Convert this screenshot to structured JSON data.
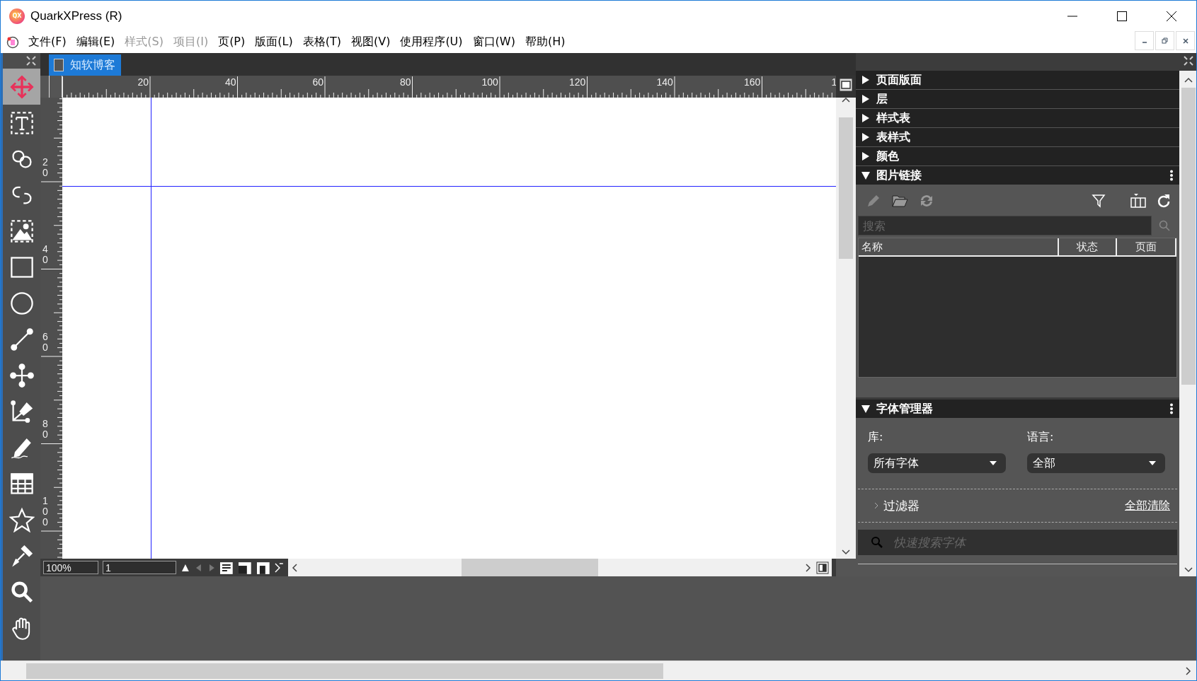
{
  "window": {
    "title": "QuarkXPress (R)",
    "logo": "QX"
  },
  "menu": [
    {
      "label": "文件(F)",
      "disabled": false
    },
    {
      "label": "编辑(E)",
      "disabled": false
    },
    {
      "label": "样式(S)",
      "disabled": true
    },
    {
      "label": "项目(I)",
      "disabled": true
    },
    {
      "label": "页(P)",
      "disabled": false
    },
    {
      "label": "版面(L)",
      "disabled": false
    },
    {
      "label": "表格(T)",
      "disabled": false
    },
    {
      "label": "视图(V)",
      "disabled": false
    },
    {
      "label": "使用程序(U)",
      "disabled": false
    },
    {
      "label": "窗口(W)",
      "disabled": false
    },
    {
      "label": "帮助(H)",
      "disabled": false
    }
  ],
  "tools": [
    {
      "kind": "move",
      "selected": true
    },
    {
      "kind": "text",
      "selected": false
    },
    {
      "kind": "link",
      "selected": false
    },
    {
      "kind": "unlink",
      "selected": false
    },
    {
      "kind": "picture",
      "selected": false
    },
    {
      "kind": "rectangle",
      "selected": false
    },
    {
      "kind": "oval",
      "selected": false
    },
    {
      "kind": "line",
      "selected": false
    },
    {
      "kind": "nodes",
      "selected": false
    },
    {
      "kind": "pen",
      "selected": false
    },
    {
      "kind": "pencil",
      "selected": false
    },
    {
      "kind": "table",
      "selected": false
    },
    {
      "kind": "star",
      "selected": false
    },
    {
      "kind": "eyedropper",
      "selected": false
    },
    {
      "kind": "zoom",
      "selected": false
    },
    {
      "kind": "hand",
      "selected": false
    }
  ],
  "document_tab": {
    "title": "知软博客",
    "selected": true
  },
  "ruler": {
    "horizontal": [
      "20",
      "40",
      "60",
      "80",
      "100",
      "120",
      "140",
      "160",
      "1"
    ],
    "vertical": [
      "20",
      "40",
      "60",
      "80",
      "100"
    ]
  },
  "view_bar": {
    "zoom": "100%",
    "page": "1"
  },
  "panels": [
    {
      "title": "页面版面",
      "expanded": false
    },
    {
      "title": "层",
      "expanded": false
    },
    {
      "title": "样式表",
      "expanded": false
    },
    {
      "title": "表样式",
      "expanded": false
    },
    {
      "title": "颜色",
      "expanded": false
    }
  ],
  "picture_links": {
    "title": "图片链接",
    "expanded": true,
    "search_placeholder": "搜索",
    "columns": [
      "名称",
      "状态",
      "页面"
    ]
  },
  "font_manager": {
    "title": "字体管理器",
    "expanded": true,
    "library_label": "库:",
    "library": "所有字体",
    "language_label": "语言:",
    "language": "全部",
    "filter": "过滤器",
    "clear_all": "全部清除",
    "search_placeholder": "快速搜索字体"
  }
}
